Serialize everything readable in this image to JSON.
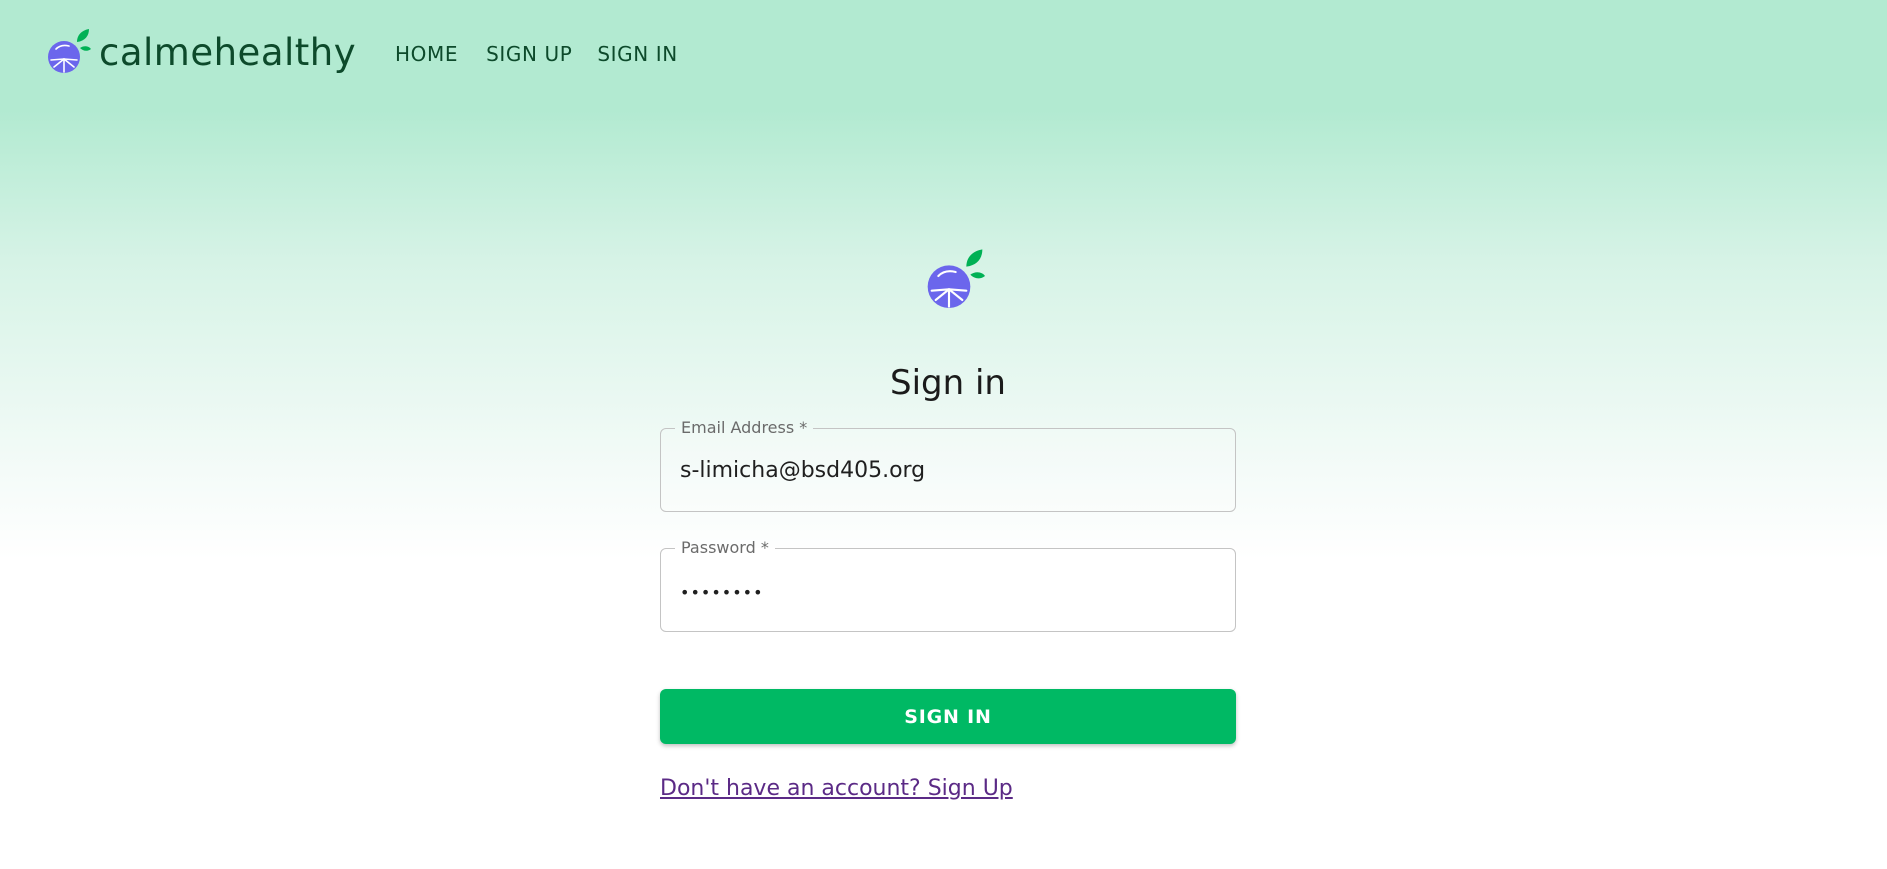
{
  "brand": {
    "name": "calmehealthy",
    "logo_icon": "blueberry-leaf-logo"
  },
  "nav": {
    "items": [
      {
        "label": "HOME"
      },
      {
        "label": "SIGN UP"
      },
      {
        "label": "SIGN IN"
      }
    ]
  },
  "form": {
    "logo_icon": "blueberry-leaf-logo",
    "title": "Sign in",
    "email": {
      "label": "Email Address *",
      "value": "s-limicha@bsd405.org"
    },
    "password": {
      "label": "Password *",
      "value": "••••••••"
    },
    "submit_label": "SIGN IN",
    "signup_link": "Don't have an account? Sign Up"
  },
  "colors": {
    "header_bg": "#b2ead1",
    "brand_text": "#0d4a2b",
    "logo_berry": "#6b66ec",
    "logo_leaf": "#00b155",
    "button": "#00b964",
    "link": "#5b2a86"
  }
}
